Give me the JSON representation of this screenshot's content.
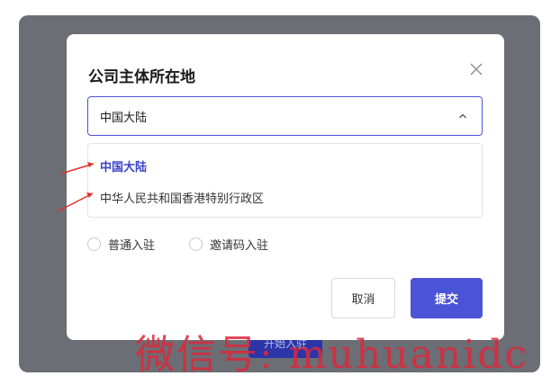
{
  "background_button": {
    "label": "开始入驻"
  },
  "dialog": {
    "title": "公司主体所在地",
    "select": {
      "value": "中国大陆"
    },
    "options": [
      "中国大陆",
      "中华人民共和国香港特别行政区"
    ],
    "radios": [
      {
        "label": "普通入驻"
      },
      {
        "label": "邀请码入驻"
      }
    ],
    "cancel_label": "取消",
    "submit_label": "提交"
  },
  "watermark": "微信号: muhuanidc",
  "colors": {
    "accent": "#4b53d6",
    "selected_option": "#3a43c7",
    "backdrop": "#6b6e74",
    "annotation": "#e0312b"
  }
}
